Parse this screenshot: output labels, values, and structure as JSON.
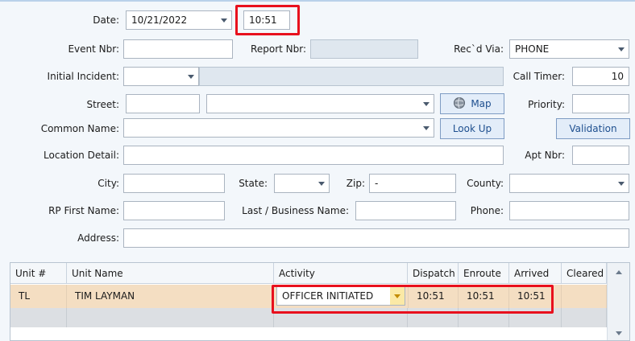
{
  "form": {
    "date_label": "Date:",
    "date_value": "10/21/2022",
    "time_value": "10:51",
    "event_nbr_label": "Event Nbr:",
    "event_nbr_value": "",
    "report_nbr_label": "Report Nbr:",
    "report_nbr_value": "",
    "recd_via_label": "Rec`d Via:",
    "recd_via_value": "PHONE",
    "initial_incident_label": "Initial Incident:",
    "initial_incident_value": "",
    "call_timer_label": "Call Timer:",
    "call_timer_value": "10",
    "street_label": "Street:",
    "street_number_value": "",
    "street_name_value": "",
    "map_button": "Map",
    "priority_label": "Priority:",
    "priority_value": "",
    "common_name_label": "Common Name:",
    "common_name_value": "",
    "lookup_button": "Look Up",
    "validation_button": "Validation",
    "location_detail_label": "Location Detail:",
    "location_detail_value": "",
    "apt_nbr_label": "Apt Nbr:",
    "apt_nbr_value": "",
    "city_label": "City:",
    "city_value": "",
    "state_label": "State:",
    "state_value": "",
    "zip_label": "Zip:",
    "zip_value": "-",
    "county_label": "County:",
    "county_value": "",
    "rp_first_name_label": "RP First Name:",
    "rp_first_name_value": "",
    "last_business_label": "Last / Business Name:",
    "last_business_value": "",
    "phone_label": "Phone:",
    "phone_value": "",
    "address_label": "Address:",
    "address_value": ""
  },
  "grid": {
    "columns": [
      "Unit #",
      "Unit Name",
      "Activity",
      "Dispatch",
      "Enroute",
      "Arrived",
      "Cleared"
    ],
    "rows": [
      {
        "unit": "TL",
        "unit_name": "TIM LAYMAN",
        "activity": "OFFICER INITIATED",
        "dispatch": "10:51",
        "enroute": "10:51",
        "arrived": "10:51",
        "cleared": ""
      }
    ]
  },
  "colors": {
    "highlight": "#e8101d",
    "selected_row": "#f4dec2",
    "button_text": "#1e4f8f"
  },
  "icons": {
    "map": "globe-icon",
    "dropdown": "chevron-down-icon"
  }
}
